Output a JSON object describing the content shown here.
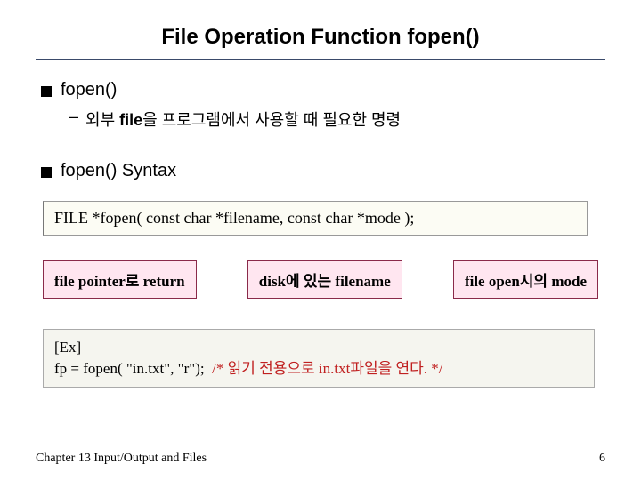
{
  "title": "File Operation Function fopen()",
  "sections": [
    {
      "heading": "fopen()",
      "sub": "외부 file을 프로그램에서 사용할 때 필요한 명령",
      "sub_bold_prefix": "file"
    },
    {
      "heading": "fopen() Syntax"
    }
  ],
  "syntax": "FILE *fopen( const char *filename, const char *mode );",
  "labels": [
    "file pointer로 return",
    "disk에 있는 filename",
    "file open시의 mode"
  ],
  "example": {
    "tag": "[Ex]",
    "code": "fp = fopen( \"in.txt\", \"r\");",
    "comment": "/* 읽기 전용으로 in.txt파일을 연다. */"
  },
  "footer": {
    "chapter": "Chapter 13  Input/Output and Files",
    "page": "6"
  }
}
